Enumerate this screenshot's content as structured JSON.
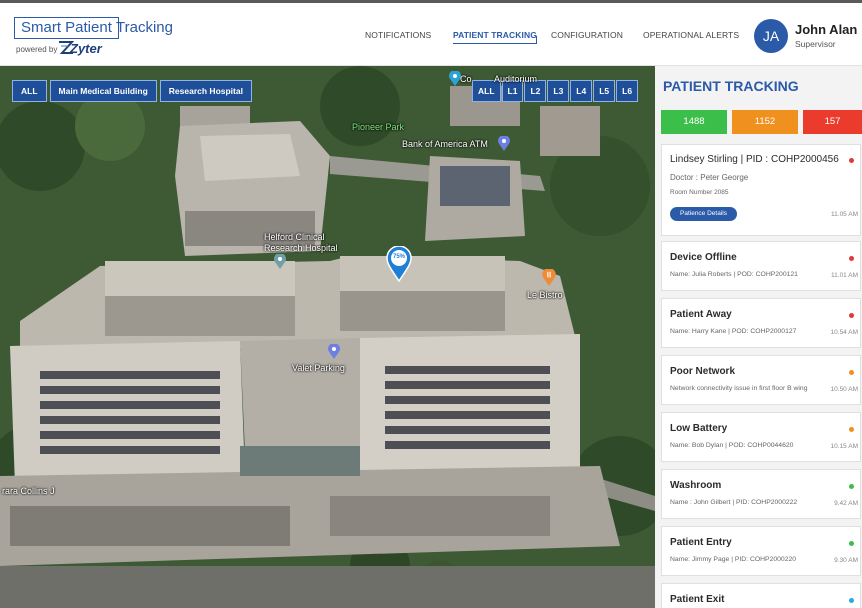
{
  "header": {
    "logo_main": "Smart Patient",
    "logo_tail": "Tracking",
    "powered_by": "powered by",
    "brand": "Zyter",
    "nav": [
      {
        "label": "NOTIFICATIONS"
      },
      {
        "label": "PATIENT TRACKING"
      },
      {
        "label": "CONFIGURATION"
      },
      {
        "label": "OPERATIONAL ALERTS"
      }
    ],
    "user": {
      "initials": "JA",
      "name": "John Alan",
      "role": "Supervisor"
    }
  },
  "map": {
    "building_buttons": [
      "ALL",
      "Main Medical Building",
      "Research Hospital"
    ],
    "floor_buttons": [
      "ALL",
      "L1",
      "L2",
      "L3",
      "L4",
      "L5",
      "L6"
    ],
    "labels": {
      "pioneer_park": "Pioneer Park",
      "bank": "Bank of America ATM",
      "helford_line1": "Helford Clinical",
      "helford_line2": "Research Hospital",
      "le_bistro": "Le Bistro",
      "valet": "Valet Parking",
      "street": "rara Collins J",
      "auditorium": "Auditorium",
      "cov": "Co"
    },
    "marker_label": "75%"
  },
  "panel": {
    "title": "PATIENT TRACKING",
    "counters": [
      {
        "value": "1488",
        "color": "#3cbf4a"
      },
      {
        "value": "1152",
        "color": "#f0901e"
      },
      {
        "value": "157",
        "color": "#ea3b2c"
      }
    ],
    "featured": {
      "title": "Lindsey Stirling  |  PID : COHP2000456",
      "doctor": "Doctor : Peter George",
      "room": "Room Number 2085",
      "button": "Patience Details",
      "time": "11.05 AM",
      "dot": "#e0393a"
    },
    "alerts": [
      {
        "title": "Device Offline",
        "sub": "Name: Julia Roberts  |  POD: COHP200121",
        "time": "11.01 AM",
        "dot": "#e0393a"
      },
      {
        "title": "Patient Away",
        "sub": "Name: Harry Kane  |  POD: COHP2000127",
        "time": "10.54 AM",
        "dot": "#e0393a"
      },
      {
        "title": "Poor Network",
        "sub": "Network connectivity issue in first floor B wing",
        "time": "10.50 AM",
        "dot": "#f0901e"
      },
      {
        "title": "Low Battery",
        "sub": "Name: Bob Dylan  |  POD: COHP0044620",
        "time": "10.15 AM",
        "dot": "#f0901e"
      },
      {
        "title": "Washroom",
        "sub": "Name : John Gilbert  |  PID: COHP2000222",
        "time": "9.42 AM",
        "dot": "#3cbf4a"
      },
      {
        "title": "Patient Entry",
        "sub": "Name: Jimmy Page  |  PID: COHP2000220",
        "time": "9.30 AM",
        "dot": "#3cbf4a"
      },
      {
        "title": "Patient Exit",
        "sub": "",
        "time": "",
        "dot": "#29a9e0"
      }
    ]
  }
}
